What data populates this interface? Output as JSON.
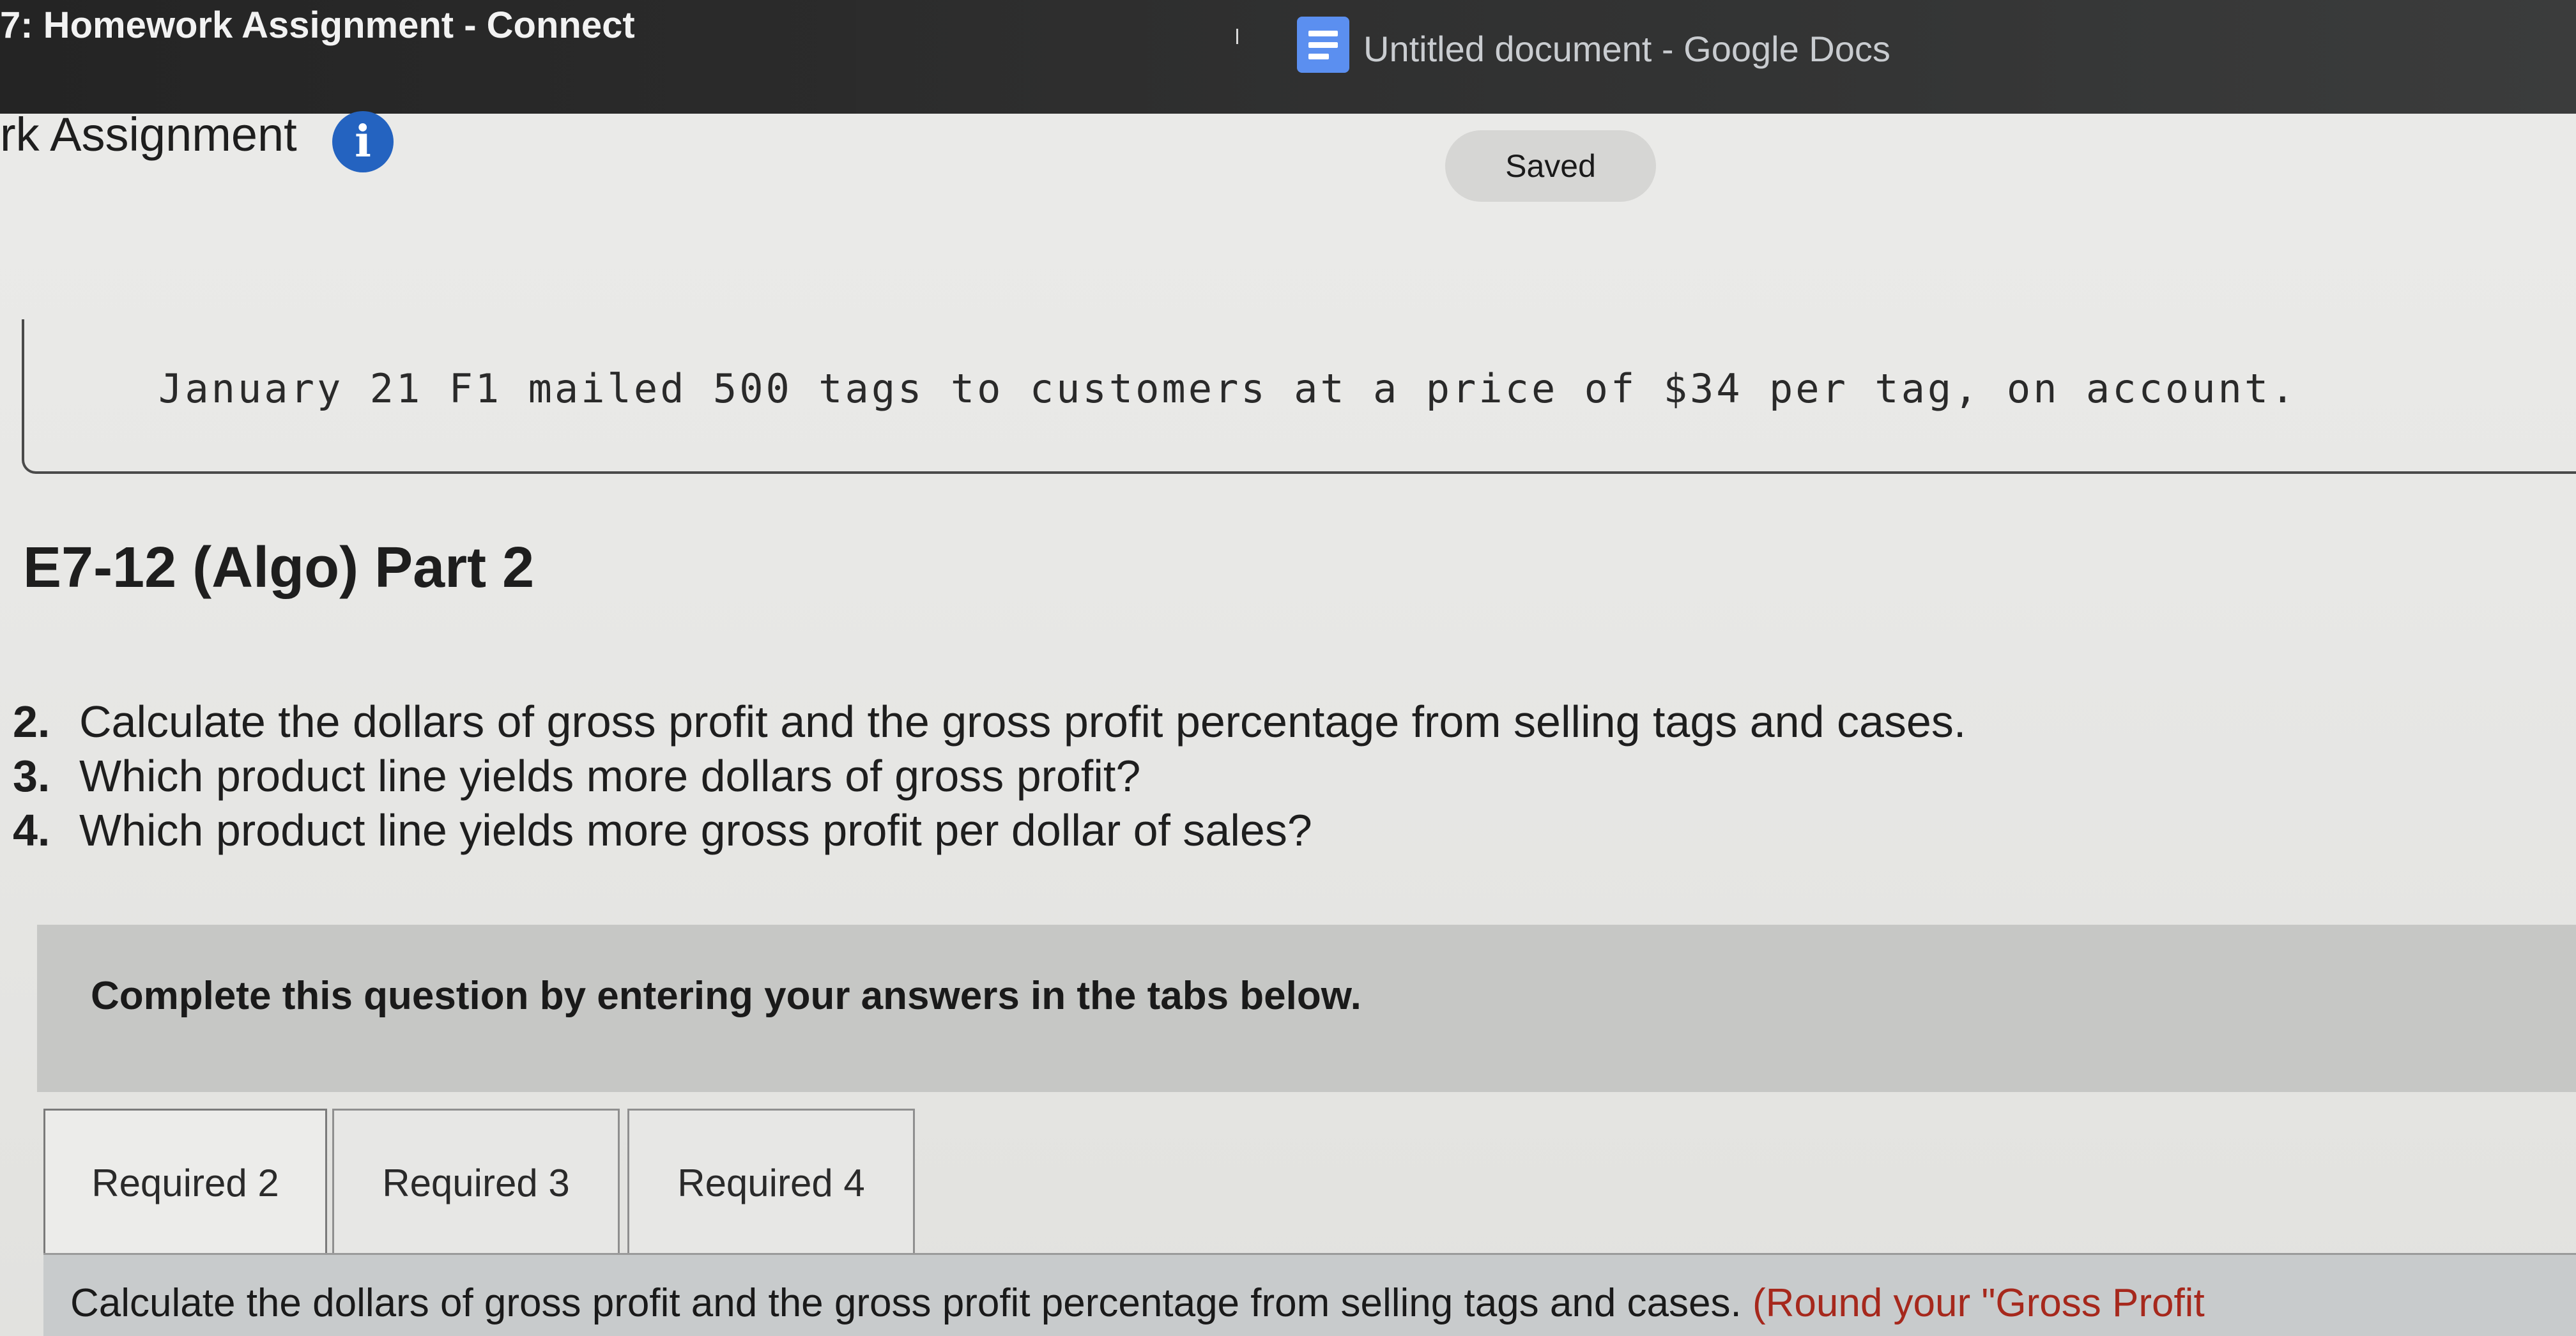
{
  "window": {
    "left_title": "7: Homework Assignment - Connect",
    "right_title": "Untitled document - Google Docs",
    "right_icon": "google-docs-icon"
  },
  "header": {
    "assignment_title": "rk Assignment",
    "info_icon": "i",
    "status": "Saved"
  },
  "question": {
    "cut_line": "January 21 F1 mailed 500 tags to customers at a price of $34 per tag, on account.",
    "section_title": "E7-12 (Algo) Part 2",
    "items": [
      {
        "num": "2.",
        "text": "Calculate the dollars of gross profit and the gross profit percentage from selling tags and cases."
      },
      {
        "num": "3.",
        "text": "Which product line yields more dollars of gross profit?"
      },
      {
        "num": "4.",
        "text": "Which product line yields more gross profit per dollar of sales?"
      }
    ],
    "instruction": "Complete this question by entering your answers in the tabs below."
  },
  "tabs": [
    {
      "label": "Required 2",
      "active": true
    },
    {
      "label": "Required 3",
      "active": false
    },
    {
      "label": "Required 4",
      "active": false
    }
  ],
  "answer": {
    "prompt": "Calculate the dollars of gross profit and the gross profit percentage from selling tags and cases.",
    "hint": "(Round your \"Gross Profit"
  },
  "colors": {
    "info_blue": "#2463c0",
    "docs_blue": "#5b8ff0",
    "hint_red": "#a6281c"
  }
}
